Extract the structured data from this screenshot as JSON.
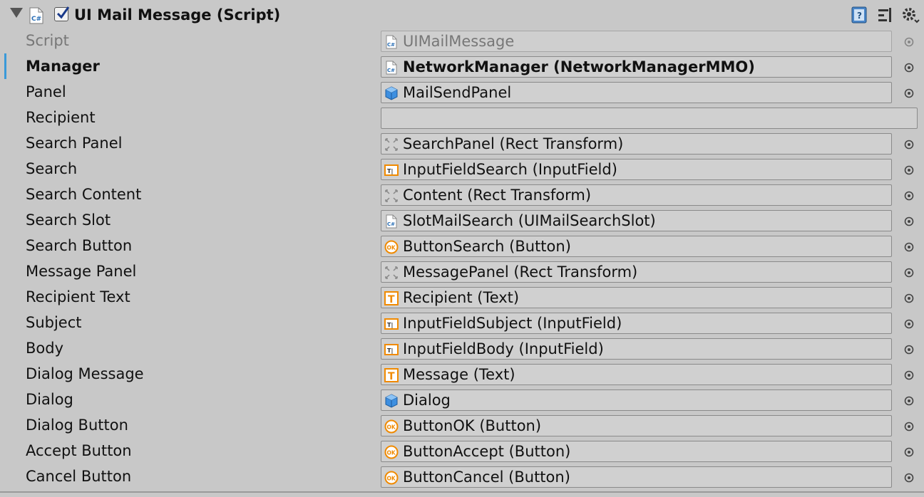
{
  "component": {
    "title": "UI Mail Message (Script)",
    "enabled": true
  },
  "header_icons": [
    "script-icon",
    "checkbox-checked-icon",
    "help-book-icon",
    "preset-sliders-icon",
    "settings-gear-icon"
  ],
  "fields": [
    {
      "label": "Script",
      "value": "UIMailMessage",
      "icon": "script-file-icon",
      "disabled": true,
      "bold": false
    },
    {
      "label": "Manager",
      "value": "NetworkManager (NetworkManagerMMO)",
      "icon": "script-file-icon",
      "disabled": false,
      "bold": true
    },
    {
      "label": "Panel",
      "value": "MailSendPanel",
      "icon": "gameobject-cube-icon",
      "disabled": false,
      "bold": false
    },
    {
      "label": "Recipient",
      "value": "",
      "icon": "",
      "disabled": false,
      "bold": false,
      "text_field": true
    },
    {
      "label": "Search Panel",
      "value": "SearchPanel (Rect Transform)",
      "icon": "rect-transform-icon",
      "disabled": false,
      "bold": false
    },
    {
      "label": "Search",
      "value": "InputFieldSearch (InputField)",
      "icon": "input-field-icon",
      "disabled": false,
      "bold": false
    },
    {
      "label": "Search Content",
      "value": "Content (Rect Transform)",
      "icon": "rect-transform-icon",
      "disabled": false,
      "bold": false
    },
    {
      "label": "Search Slot",
      "value": "SlotMailSearch (UIMailSearchSlot)",
      "icon": "script-file-icon",
      "disabled": false,
      "bold": false
    },
    {
      "label": "Search Button",
      "value": "ButtonSearch (Button)",
      "icon": "button-ok-icon",
      "disabled": false,
      "bold": false
    },
    {
      "label": "Message Panel",
      "value": "MessagePanel (Rect Transform)",
      "icon": "rect-transform-icon",
      "disabled": false,
      "bold": false
    },
    {
      "label": "Recipient Text",
      "value": "Recipient (Text)",
      "icon": "text-icon",
      "disabled": false,
      "bold": false
    },
    {
      "label": "Subject",
      "value": "InputFieldSubject (InputField)",
      "icon": "input-field-icon",
      "disabled": false,
      "bold": false
    },
    {
      "label": "Body",
      "value": "InputFieldBody (InputField)",
      "icon": "input-field-icon",
      "disabled": false,
      "bold": false
    },
    {
      "label": "Dialog Message",
      "value": "Message (Text)",
      "icon": "text-icon",
      "disabled": false,
      "bold": false
    },
    {
      "label": "Dialog",
      "value": "Dialog",
      "icon": "gameobject-cube-icon",
      "disabled": false,
      "bold": false
    },
    {
      "label": "Dialog Button",
      "value": "ButtonOK (Button)",
      "icon": "button-ok-icon",
      "disabled": false,
      "bold": false
    },
    {
      "label": "Accept Button",
      "value": "ButtonAccept (Button)",
      "icon": "button-ok-icon",
      "disabled": false,
      "bold": false
    },
    {
      "label": "Cancel Button",
      "value": "ButtonCancel (Button)",
      "icon": "button-ok-icon",
      "disabled": false,
      "bold": false
    }
  ],
  "colors": {
    "background": "#c8c8c8",
    "field_bg": "#d0d0d0",
    "accent": "#3a9ad9",
    "text_icon_orange": "#f08a00",
    "cube_blue": "#2f7fd6"
  }
}
